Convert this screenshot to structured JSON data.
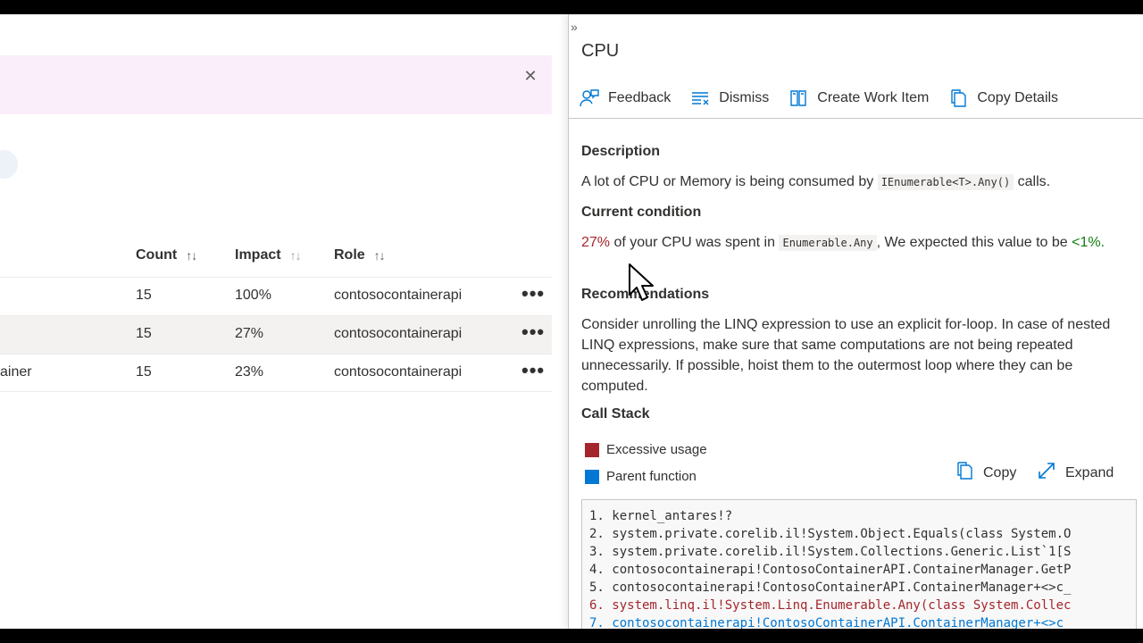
{
  "table": {
    "headers": [
      {
        "label": "Count"
      },
      {
        "label": "Impact"
      },
      {
        "label": "Role"
      }
    ],
    "rows": [
      {
        "name": "",
        "count": "15",
        "impact": "100%",
        "role": "contosocontainerapi"
      },
      {
        "name": "",
        "count": "15",
        "impact": "27%",
        "role": "contosocontainerapi"
      },
      {
        "name": "ainer",
        "count": "15",
        "impact": "23%",
        "role": "contosocontainerapi"
      }
    ],
    "more_label": "•••"
  },
  "banner": {
    "close_glyph": "✕"
  },
  "panel": {
    "collapse_glyph": "»",
    "title": "CPU",
    "toolbar": {
      "feedback": "Feedback",
      "dismiss": "Dismiss",
      "create_work_item": "Create Work Item",
      "copy_details": "Copy Details"
    },
    "description": {
      "heading": "Description",
      "text_before": "A lot of CPU or Memory is being consumed by",
      "code": "IEnumerable<T>.Any()",
      "text_after": "calls."
    },
    "current_condition": {
      "heading": "Current condition",
      "percent": "27%",
      "text_mid": "of your CPU was spent in",
      "code": "Enumerable.Any",
      "text_after": ", We expected this value to be",
      "expected": "<1%."
    },
    "recommendations": {
      "heading": "Recommendations",
      "text": "Consider unrolling the LINQ expression to use an explicit for-loop. In case of nested LINQ expressions, make sure that same computations are not being repeated unnecessarily. If possible, hoist them to the outermost loop where they can be computed."
    },
    "call_stack": {
      "heading": "Call Stack",
      "legend": [
        {
          "label": "Excessive usage",
          "color": "#a4262c"
        },
        {
          "label": "Parent function",
          "color": "#0078d4"
        }
      ],
      "copy_label": "Copy",
      "expand_label": "Expand",
      "lines": [
        {
          "text": "1. kernel_antares!?",
          "kind": "normal"
        },
        {
          "text": "2. system.private.corelib.il!System.Object.Equals(class System.O",
          "kind": "normal"
        },
        {
          "text": "3. system.private.corelib.il!System.Collections.Generic.List`1[S",
          "kind": "normal"
        },
        {
          "text": "4. contosocontainerapi!ContosoContainerAPI.ContainerManager.GetP",
          "kind": "normal"
        },
        {
          "text": "5. contosocontainerapi!ContosoContainerAPI.ContainerManager+<>c_",
          "kind": "normal"
        },
        {
          "text": "6. system.linq.il!System.Linq.Enumerable.Any(class System.Collec",
          "kind": "excess"
        },
        {
          "text": "7. contosocontainerapi!ContosoContainerAPI.ContainerManager+<>c",
          "kind": "parent"
        }
      ]
    }
  },
  "colors": {
    "excessive": "#a4262c",
    "parent": "#0078d4",
    "good": "#107c10",
    "banner": "#fbeefb"
  }
}
